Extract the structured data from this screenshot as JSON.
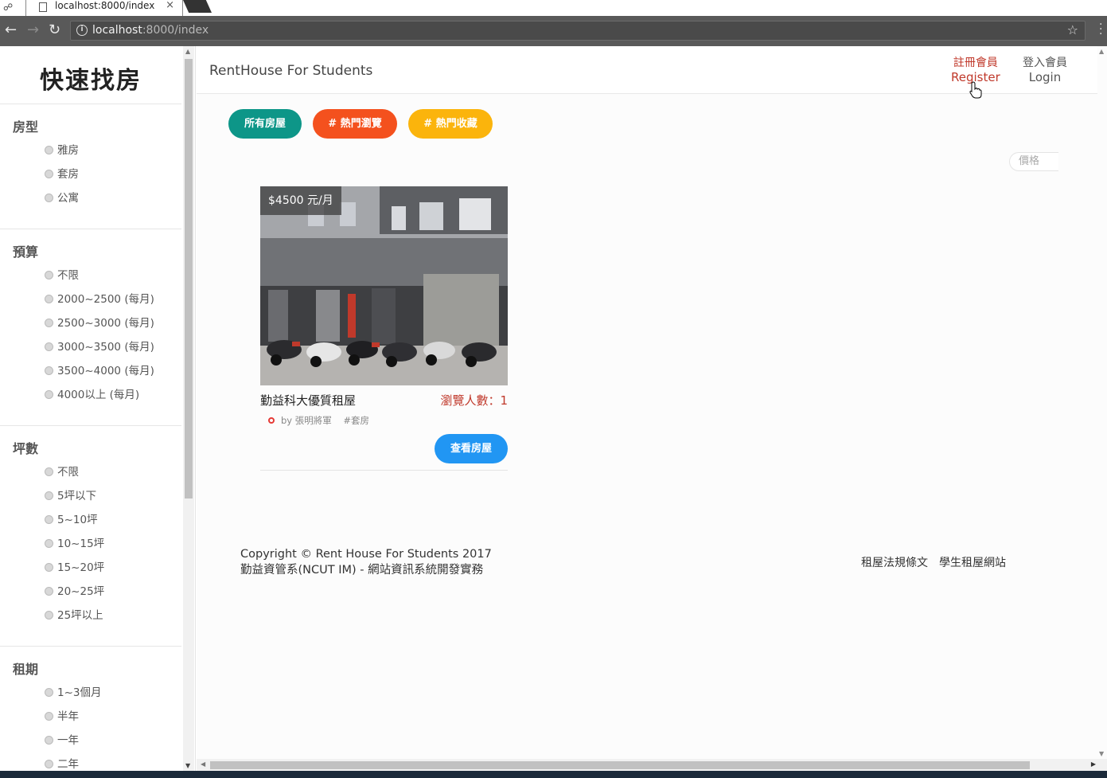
{
  "browser": {
    "tab_title": "localhost:8000/index",
    "tab_close": "×",
    "url_host": "localhost",
    "url_path": ":8000/index"
  },
  "sidebar": {
    "title": "快速找房",
    "sections": [
      {
        "heading": "房型",
        "options": [
          "雅房",
          "套房",
          "公寓"
        ]
      },
      {
        "heading": "預算",
        "options": [
          "不限",
          "2000~2500 (每月)",
          "2500~3000 (每月)",
          "3000~3500 (每月)",
          "3500~4000 (每月)",
          "4000以上 (每月)"
        ]
      },
      {
        "heading": "坪數",
        "options": [
          "不限",
          "5坪以下",
          "5~10坪",
          "10~15坪",
          "15~20坪",
          "20~25坪",
          "25坪以上"
        ]
      },
      {
        "heading": "租期",
        "options": [
          "1~3個月",
          "半年",
          "一年",
          "二年"
        ]
      }
    ]
  },
  "header": {
    "brand": "RentHouse For Students",
    "register_zh": "註冊會員",
    "register_en": "Register",
    "login_zh": "登入會員",
    "login_en": "Login"
  },
  "filters": {
    "all": "所有房屋",
    "hot_views": "# 熱門瀏覽",
    "hot_favorites": "# 熱門收藏",
    "price_sort": "價格"
  },
  "listing": {
    "price": "$4500 元/月",
    "name": "勤益科大優質租屋",
    "views": "瀏覽人數：1",
    "author": "by 張明將軍",
    "tag": "#套房",
    "button": "查看房屋"
  },
  "footer": {
    "copyright": "Copyright © Rent House For Students 2017",
    "department": "勤益資管系(NCUT IM) - 網站資訊系統開發實務",
    "link_regulations": "租屋法規條文",
    "link_student_rent": "學生租屋網站"
  },
  "colors": {
    "teal": "#0d9688",
    "orange": "#f4511e",
    "amber": "#fbb40c",
    "blue": "#2196f3",
    "accent_red": "#c0392b"
  }
}
